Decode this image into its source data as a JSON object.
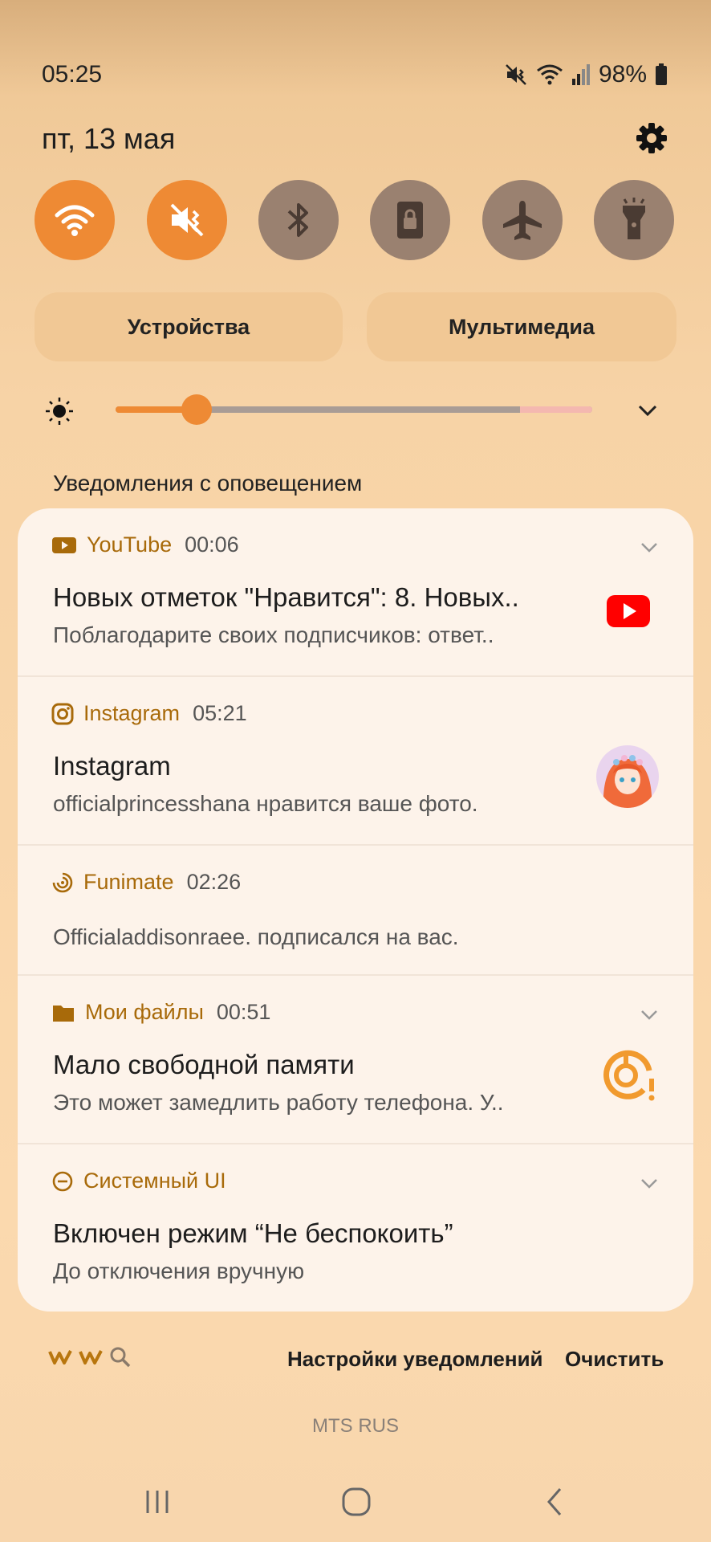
{
  "status_bar": {
    "time": "05:25",
    "battery": "98%",
    "icons": [
      "mute-icon",
      "wifi-icon",
      "signal-icon",
      "battery-icon"
    ]
  },
  "header": {
    "date": "пт, 13 мая"
  },
  "quick_toggles": [
    {
      "icon": "wifi-icon",
      "state": "on"
    },
    {
      "icon": "mute-icon",
      "state": "on"
    },
    {
      "icon": "bluetooth-icon",
      "state": "off"
    },
    {
      "icon": "screen-lock-icon",
      "state": "off"
    },
    {
      "icon": "airplane-icon",
      "state": "off"
    },
    {
      "icon": "flashlight-icon",
      "state": "off"
    }
  ],
  "panel_buttons": {
    "devices": "Устройства",
    "media": "Мультимедиа"
  },
  "brightness": {
    "level": 0.17
  },
  "notifications_heading": "Уведомления с оповещением",
  "notifications": [
    {
      "app": "YouTube",
      "time": "00:06",
      "title": "Новых отметок \"Нравится\": 8. Новых..",
      "body": "Поблагодарите своих подписчиков: ответ..",
      "icon": "youtube-icon"
    },
    {
      "app": "Instagram",
      "time": "05:21",
      "title": "Instagram",
      "body": "officialprincesshana нравится ваше фото.",
      "icon": "instagram-icon"
    },
    {
      "app": "Funimate",
      "time": "02:26",
      "title": "",
      "body": "Officialaddisonraee. подписался на вас.",
      "icon": "funimate-icon"
    },
    {
      "app": "Мои файлы",
      "time": "00:51",
      "title": "Мало свободной памяти",
      "body": "Это может замедлить работу телефона. У..",
      "icon": "folder-icon"
    },
    {
      "app": "Системный UI",
      "time": "",
      "title": "Включен режим “Не беспокоить”",
      "body": "До отключения вручную",
      "icon": "dnd-icon"
    }
  ],
  "footer": {
    "notification_settings": "Настройки уведомлений",
    "clear": "Очистить",
    "carrier": "MTS RUS"
  },
  "colors": {
    "accent": "#ee8a34",
    "app_name": "#a86a0a",
    "toggle_off": "#9a8170",
    "card": "#fdf3ea"
  }
}
